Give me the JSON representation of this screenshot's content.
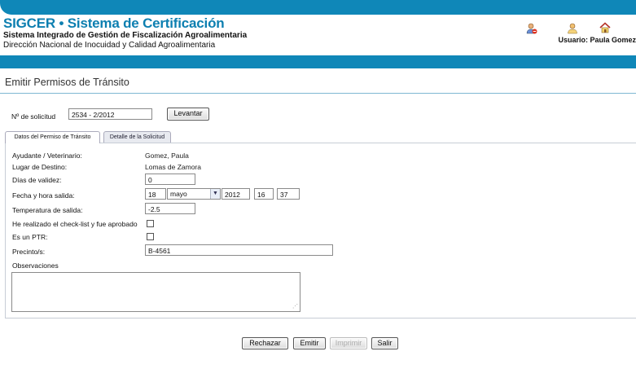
{
  "header": {
    "title": "SIGCER • Sistema de Certificación",
    "subtitle": "Sistema Integrado de Gestión de Fiscalización Agroalimentaria",
    "department": "Dirección Nacional de Inocuidad y Calidad Agroalimentaria",
    "user": "Usuario: Paula Gomez",
    "icons": [
      "user-remove-icon",
      "user-icon",
      "home-icon"
    ],
    "colors": {
      "brand": "#0d7fb0",
      "bar": "#0f87b8"
    }
  },
  "page": {
    "title": "Emitir Permisos de Tránsito"
  },
  "request": {
    "label": "Nº de solicitud",
    "value": "2534 - 2/2012",
    "button": "Levantar"
  },
  "tabs": [
    {
      "label": "Datos del Permiso de Tránsito",
      "active": true
    },
    {
      "label": "Detalle de la Solicitud",
      "active": false
    }
  ],
  "form": {
    "vet_label": "Ayudante / Veterinario:",
    "vet_value": "Gomez, Paula",
    "dest_label": "Lugar de Destino:",
    "dest_value": "Lomas de Zamora",
    "days_label": "Días de validez:",
    "days_value": "0",
    "date_label": "Fecha y hora salida:",
    "date_day": "18",
    "date_month": "mayo",
    "date_year": "2012",
    "date_hour": "16",
    "date_min": "37",
    "temp_label": "Temperatura de salida:",
    "temp_value": "-2.5",
    "checklist_label": "He realizado el check-list y fue aprobado",
    "checklist_checked": false,
    "ptr_label": "Es un PTR:",
    "ptr_checked": false,
    "seal_label": "Precinto/s:",
    "seal_value": "B-4561",
    "obs_label": "Observaciones",
    "obs_value": ""
  },
  "actions": {
    "reject": "Rechazar",
    "emit": "Emitir",
    "print": "Imprimir",
    "exit": "Salir"
  }
}
